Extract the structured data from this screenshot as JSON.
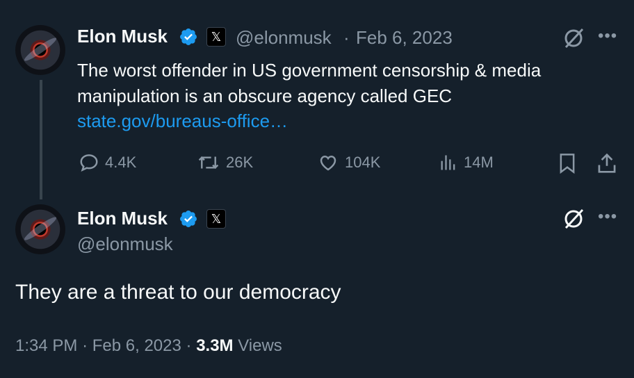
{
  "quoted_tweet": {
    "author_name": "Elon Musk",
    "handle": "@elonmusk",
    "separator": "·",
    "date": "Feb 6, 2023",
    "text_line1": "The worst offender in US government censorship & media",
    "text_line2": "manipulation is an obscure agency called GEC",
    "link": "state.gov/bureaus-office…",
    "stats": {
      "replies": "4.4K",
      "reposts": "26K",
      "likes": "104K",
      "views": "14M"
    }
  },
  "main_tweet": {
    "author_name": "Elon Musk",
    "handle": "@elonmusk",
    "text": "They are a threat to our democracy",
    "time": "1:34 PM",
    "separator": "·",
    "date": "Feb 6, 2023",
    "separator2": "·",
    "views_count": "3.3M",
    "views_label": "Views"
  },
  "icons": {
    "verified": "verified-badge-icon",
    "x_badge": "x-logo-icon",
    "grok": "grok-icon",
    "more": "more-icon",
    "reply": "reply-icon",
    "repost": "repost-icon",
    "like": "heart-icon",
    "views": "analytics-icon",
    "bookmark": "bookmark-icon",
    "share": "share-icon"
  },
  "colors": {
    "background": "#15202b",
    "text": "#f7f9f9",
    "muted": "#8b98a5",
    "link": "#1d9bf0",
    "verified": "#1d9bf0"
  }
}
